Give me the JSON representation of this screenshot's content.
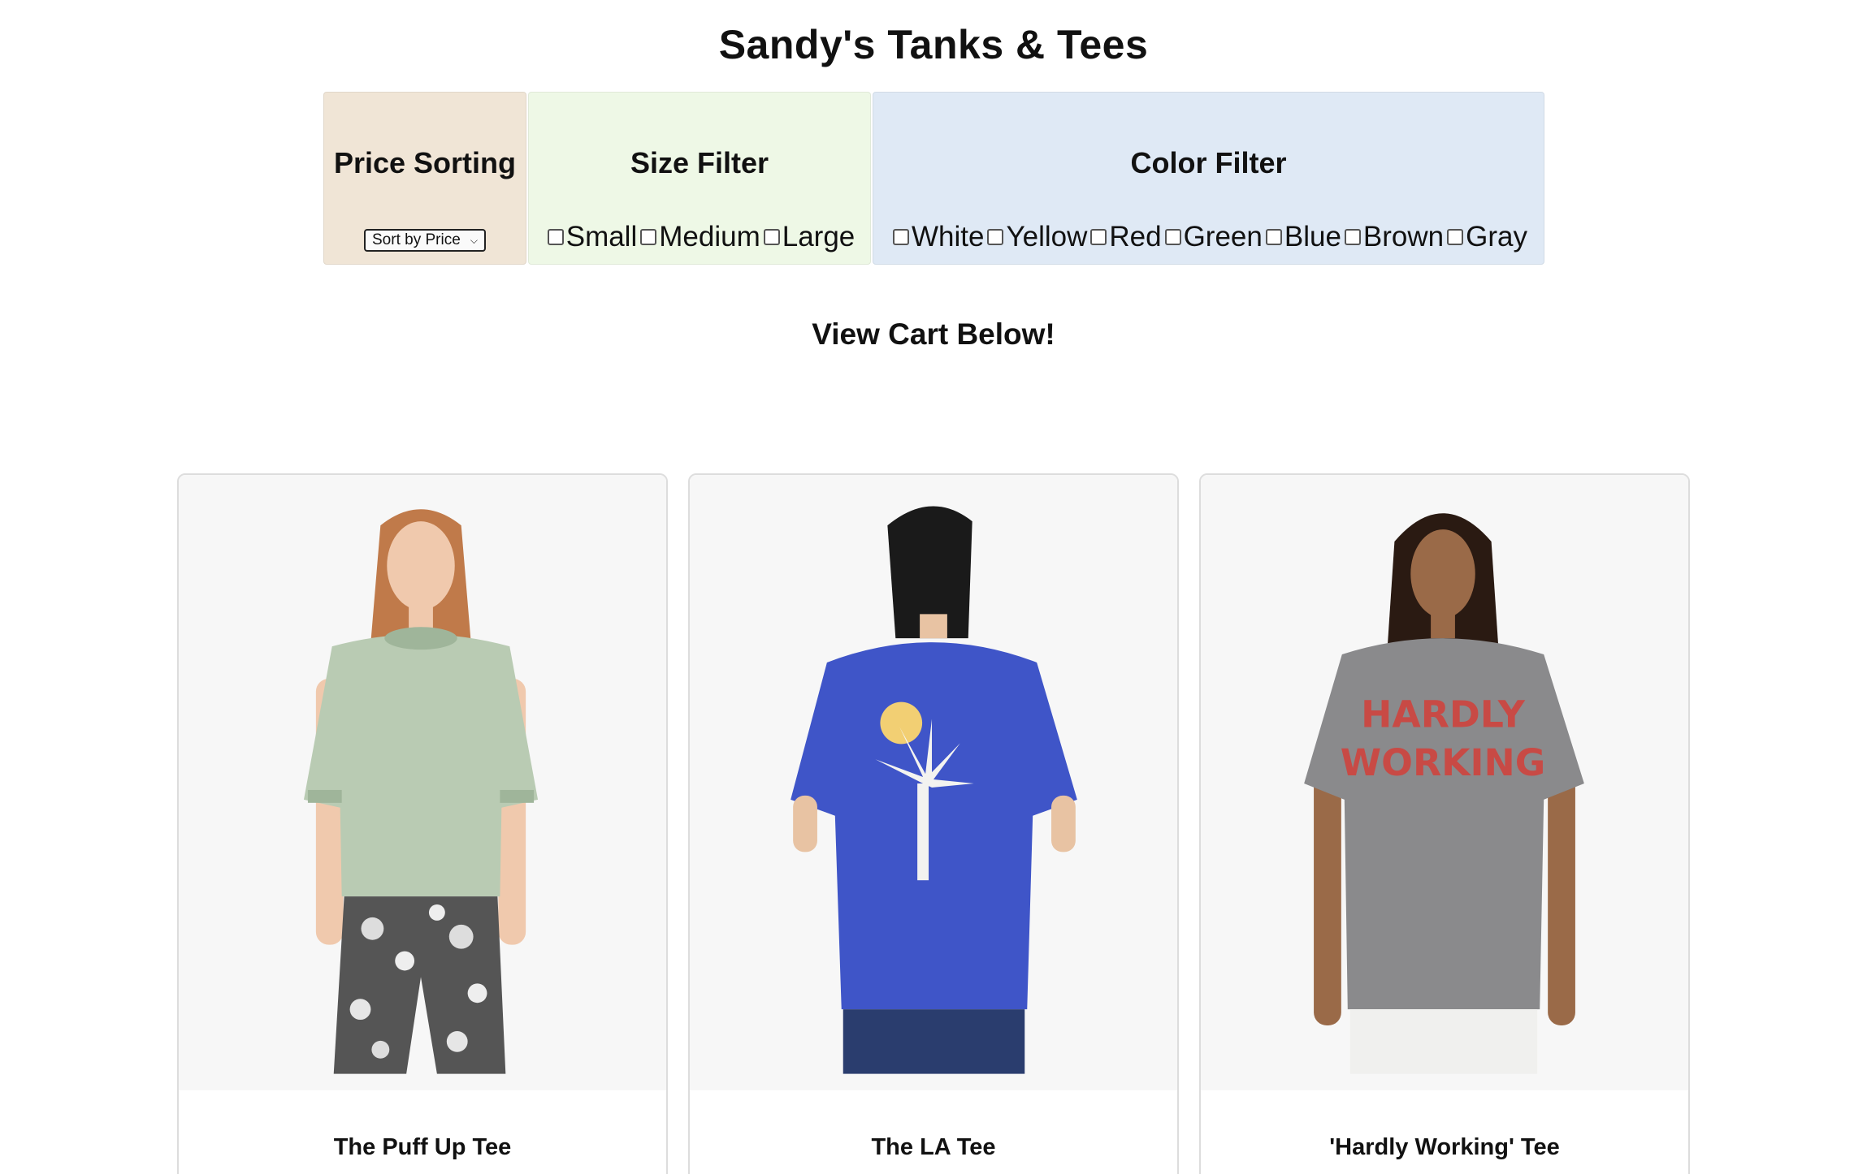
{
  "header": {
    "title": "Sandy's Tanks & Tees"
  },
  "filters": {
    "price": {
      "heading": "Price Sorting",
      "select_value": "Sort by Price"
    },
    "size": {
      "heading": "Size Filter",
      "options": [
        "Small",
        "Medium",
        "Large"
      ]
    },
    "color": {
      "heading": "Color Filter",
      "options": [
        "White",
        "Yellow",
        "Red",
        "Green",
        "Blue",
        "Brown",
        "Gray"
      ]
    }
  },
  "cart": {
    "heading": "View Cart Below!"
  },
  "products": [
    {
      "name": "The Puff Up Tee",
      "shirt_color": "#b9cbb3"
    },
    {
      "name": "The LA Tee",
      "shirt_color": "#3f55c8"
    },
    {
      "name": "'Hardly Working' Tee",
      "shirt_color": "#8a8a8c",
      "print_text": [
        "HARDLY",
        "WORKING"
      ]
    }
  ]
}
